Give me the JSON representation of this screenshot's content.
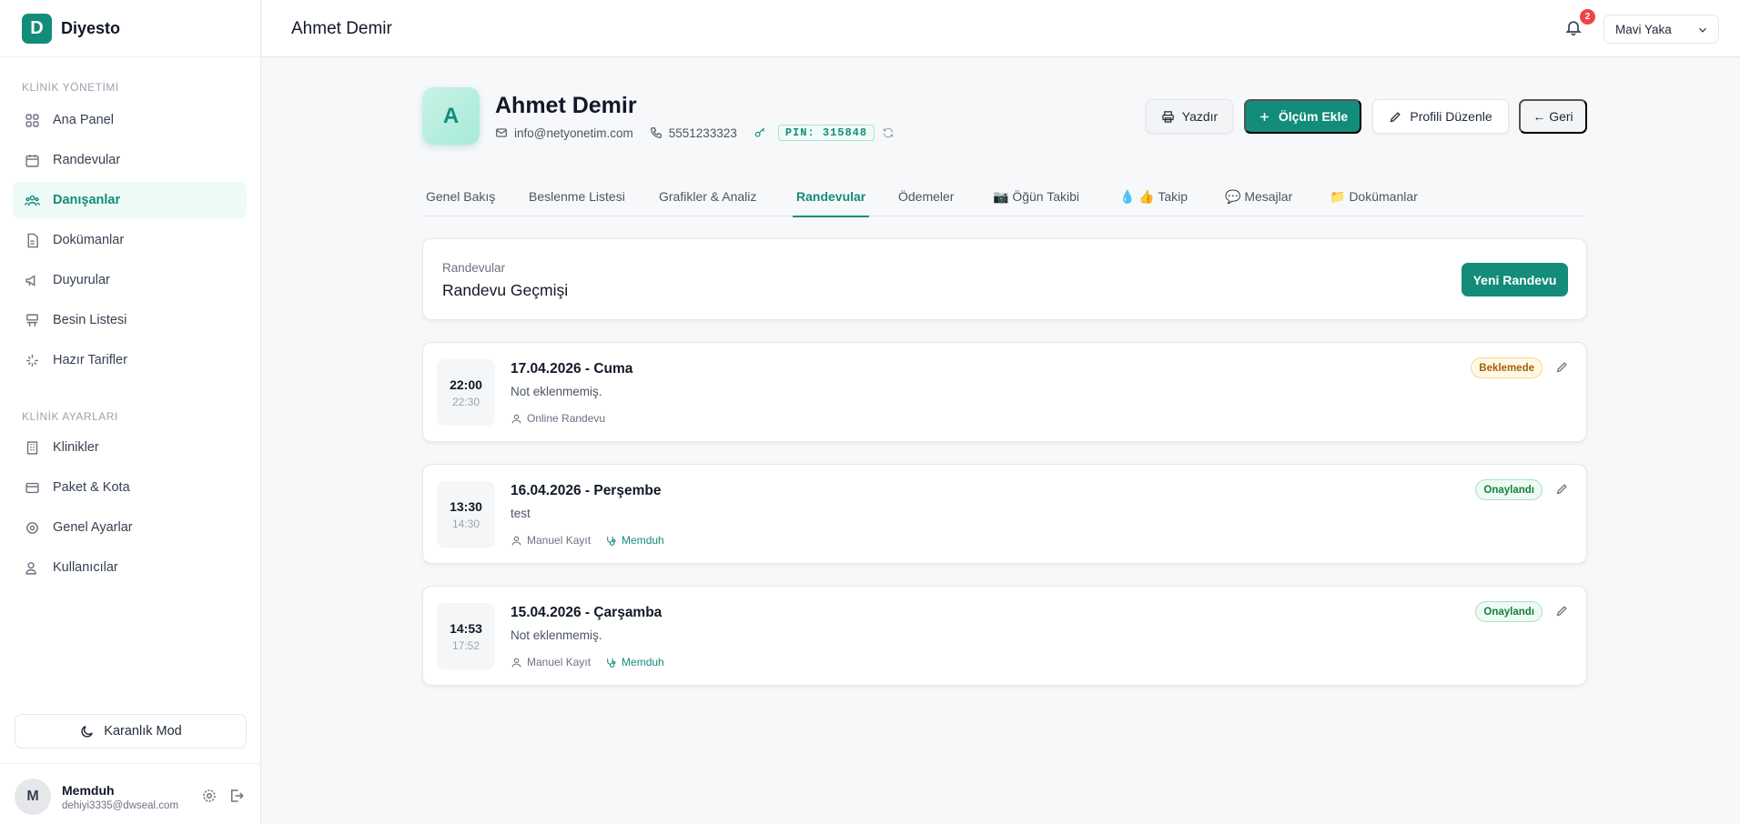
{
  "brand": {
    "logo_letter": "D",
    "name": "Diyesto",
    "color": "#138c7a"
  },
  "sidebar": {
    "sections": [
      {
        "label": "KLİNİK YÖNETİMİ"
      },
      {
        "label": "KLİNİK AYARLARI"
      }
    ],
    "items": [
      {
        "label": "Ana Panel",
        "icon": "grid-icon"
      },
      {
        "label": "Randevular",
        "icon": "calendar-icon"
      },
      {
        "label": "Danışanlar",
        "icon": "users-icon",
        "active": true
      },
      {
        "label": "Dokümanlar",
        "icon": "file-icon"
      },
      {
        "label": "Duyurular",
        "icon": "megaphone-icon"
      },
      {
        "label": "Besin Listesi",
        "icon": "list-icon"
      },
      {
        "label": "Hazır Tarifler",
        "icon": "sparkle-icon"
      },
      {
        "label": "Klinikler",
        "icon": "building-icon"
      },
      {
        "label": "Paket & Kota",
        "icon": "card-icon"
      },
      {
        "label": "Genel Ayarlar",
        "icon": "gear-icon"
      },
      {
        "label": "Kullanıcılar",
        "icon": "user-group-icon"
      }
    ],
    "dark_mode_label": "Karanlık Mod",
    "user": {
      "initial": "M",
      "name": "Memduh",
      "email": "dehiyi3335@dwseal.com"
    }
  },
  "topbar": {
    "title": "Ahmet Demir",
    "notification_count": "2",
    "theme_value": "Mavi Yaka"
  },
  "profile": {
    "initial": "A",
    "name": "Ahmet Demir",
    "email": "info@netyonetim.com",
    "phone": "5551233323",
    "pin": "PIN: 315848",
    "buttons": {
      "print": "Yazdır",
      "add_measure": "Ölçüm Ekle",
      "edit_profile": "Profili Düzenle",
      "back": "← Geri"
    }
  },
  "tabs": [
    {
      "label": "Genel Bakış"
    },
    {
      "label": "Beslenme Listesi"
    },
    {
      "label": "Grafikler & Analiz"
    },
    {
      "label": "Randevular",
      "active": true
    },
    {
      "label": "Ödemeler"
    },
    {
      "label": "📷 Öğün Takibi"
    },
    {
      "label": "💧 👍 Takip"
    },
    {
      "label": "💬 Mesajlar"
    },
    {
      "label": "📁 Dokümanlar"
    }
  ],
  "appointments_header": {
    "subtitle": "Randevular",
    "title": "Randevu Geçmişi",
    "new_button": "Yeni Randevu"
  },
  "appointments": [
    {
      "start": "22:00",
      "end": "22:30",
      "date": "17.04.2026 - Cuma",
      "note": "Not eklenmemiş.",
      "type": "Online Randevu",
      "dietitian": "",
      "status": "Beklemede",
      "status_kind": "pending"
    },
    {
      "start": "13:30",
      "end": "14:30",
      "date": "16.04.2026 - Perşembe",
      "note": "test",
      "type": "Manuel Kayıt",
      "dietitian": "Memduh",
      "status": "Onaylandı",
      "status_kind": "ok"
    },
    {
      "start": "14:53",
      "end": "17:52",
      "date": "15.04.2026 - Çarşamba",
      "note": "Not eklenmemiş.",
      "type": "Manuel Kayıt",
      "dietitian": "Memduh",
      "status": "Onaylandı",
      "status_kind": "ok"
    }
  ]
}
